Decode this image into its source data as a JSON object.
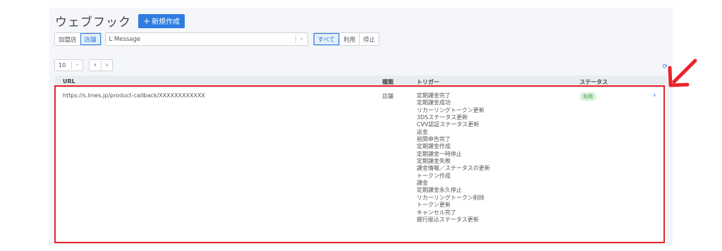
{
  "header": {
    "title": "ウェブフック",
    "new_button": "新規作成",
    "new_button_icon": "plus-icon"
  },
  "filters": {
    "scope_options": [
      "加盟店",
      "店舗"
    ],
    "scope_selected": "店舗",
    "account_select": "L Message",
    "status_options": [
      "すべて",
      "利用",
      "停止"
    ],
    "status_selected": "すべて"
  },
  "pager": {
    "page_size": "10",
    "prev": "‹",
    "next": "›"
  },
  "table": {
    "headers": {
      "url": "URL",
      "kind": "種類",
      "trigger": "トリガー",
      "status": "ステータス"
    },
    "rows": [
      {
        "url": "https://s.lmes.jp/product-callback/XXXXXXXXXXXX",
        "kind": "店舗",
        "triggers": [
          "定期課金完了",
          "定期課金成功",
          "リカーリングトークン更新",
          "3DSステータス更新",
          "CVV認証ステータス更新",
          "返金",
          "税関申告完了",
          "定期課金作成",
          "定期課金一時停止",
          "定期課金失敗",
          "課金情報／ステータスの更新",
          "トークン作成",
          "課金",
          "定期課金永久停止",
          "リカーリングトークン削除",
          "トークン更新",
          "キャンセル完了",
          "銀行振込ステータス更新"
        ],
        "status": "利用"
      }
    ]
  },
  "colors": {
    "accent": "#2e7ce0",
    "highlight": "#e8232b",
    "status_bg": "#d9f2dc",
    "status_text": "#3d9a4a"
  },
  "icons": [
    "plus-icon",
    "chevron-down-icon",
    "chevron-left-icon",
    "chevron-right-icon",
    "refresh-icon",
    "annotation-arrow-icon"
  ]
}
